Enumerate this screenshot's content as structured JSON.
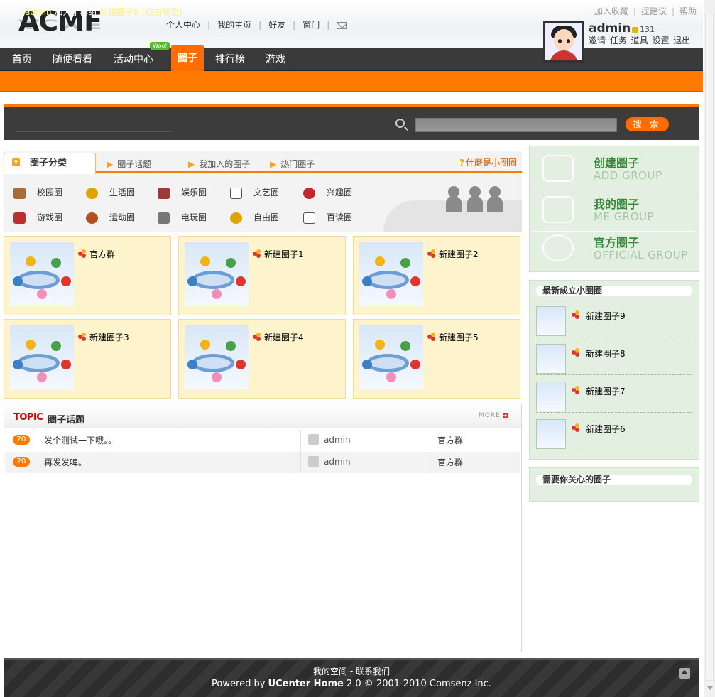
{
  "logo": "ACMF",
  "topnav": [
    "个人中心",
    "我的主页",
    "好友",
    "窗门"
  ],
  "toplinks": [
    "加入收藏",
    "提建议",
    "帮助"
  ],
  "user": {
    "name": "admin",
    "credit": "131",
    "menu": "邀请 任务 道具 设置 退出"
  },
  "nav": {
    "items": [
      "首页",
      "随便看看",
      "活动中心",
      "圈子",
      "排行榜",
      "游戏"
    ],
    "badge": "Woo!"
  },
  "notice": {
    "user": "admin",
    "action": "加入了群组",
    "group": "新建圈子8",
    "type": "(自由联盟)"
  },
  "search": {
    "button": "搜 索",
    "placeholder": ""
  },
  "categories": {
    "tabs": {
      "active": "圈子分类",
      "others": [
        "圈子话题",
        "我加入的圈子",
        "热门圈子"
      ]
    },
    "help": "什麼是小圈圈",
    "row1": [
      "校园圈",
      "生活圈",
      "娱乐圈",
      "文艺圈",
      "兴趣圈"
    ],
    "row2": [
      "游戏圈",
      "运动圈",
      "电玩圈",
      "自由圈",
      "百读圈"
    ]
  },
  "groups": [
    "官方群",
    "新建圈子1",
    "新建圈子2",
    "新建圈子3",
    "新建圈子4",
    "新建圈子5"
  ],
  "topic": {
    "tag": "TOPIC",
    "title": "圈子话题",
    "more": "MORE",
    "rows": [
      {
        "count": "20",
        "title": "发个测试一下哦。。",
        "user": "admin",
        "group": "官方群"
      },
      {
        "count": "20",
        "title": "再发发啤。",
        "user": "admin",
        "group": "官方群"
      }
    ]
  },
  "sidebar": {
    "links": [
      {
        "title": "创建圈子",
        "sub": "ADD GROUP"
      },
      {
        "title": "我的圈子",
        "sub": "ME GROUP"
      },
      {
        "title": "官方圈子",
        "sub": "OFFICIAL GROUP"
      }
    ],
    "newest_title": "最新成立小圈圈",
    "newest": [
      "新建圈子9",
      "新建圈子8",
      "新建圈子7",
      "新建圈子6"
    ],
    "care_title": "需要你关心的圈子"
  },
  "footer": {
    "links": "我的空间 - 联系我们",
    "powered": "Powered by",
    "product": "UCenter Home",
    "copy": "2.0 © 2001-2010 Comsenz Inc."
  },
  "colors": {
    "accent": "#ff7a00",
    "nav": "#3a3a3a",
    "sidebar": "#e3efe0",
    "card": "#fdf4cd"
  }
}
